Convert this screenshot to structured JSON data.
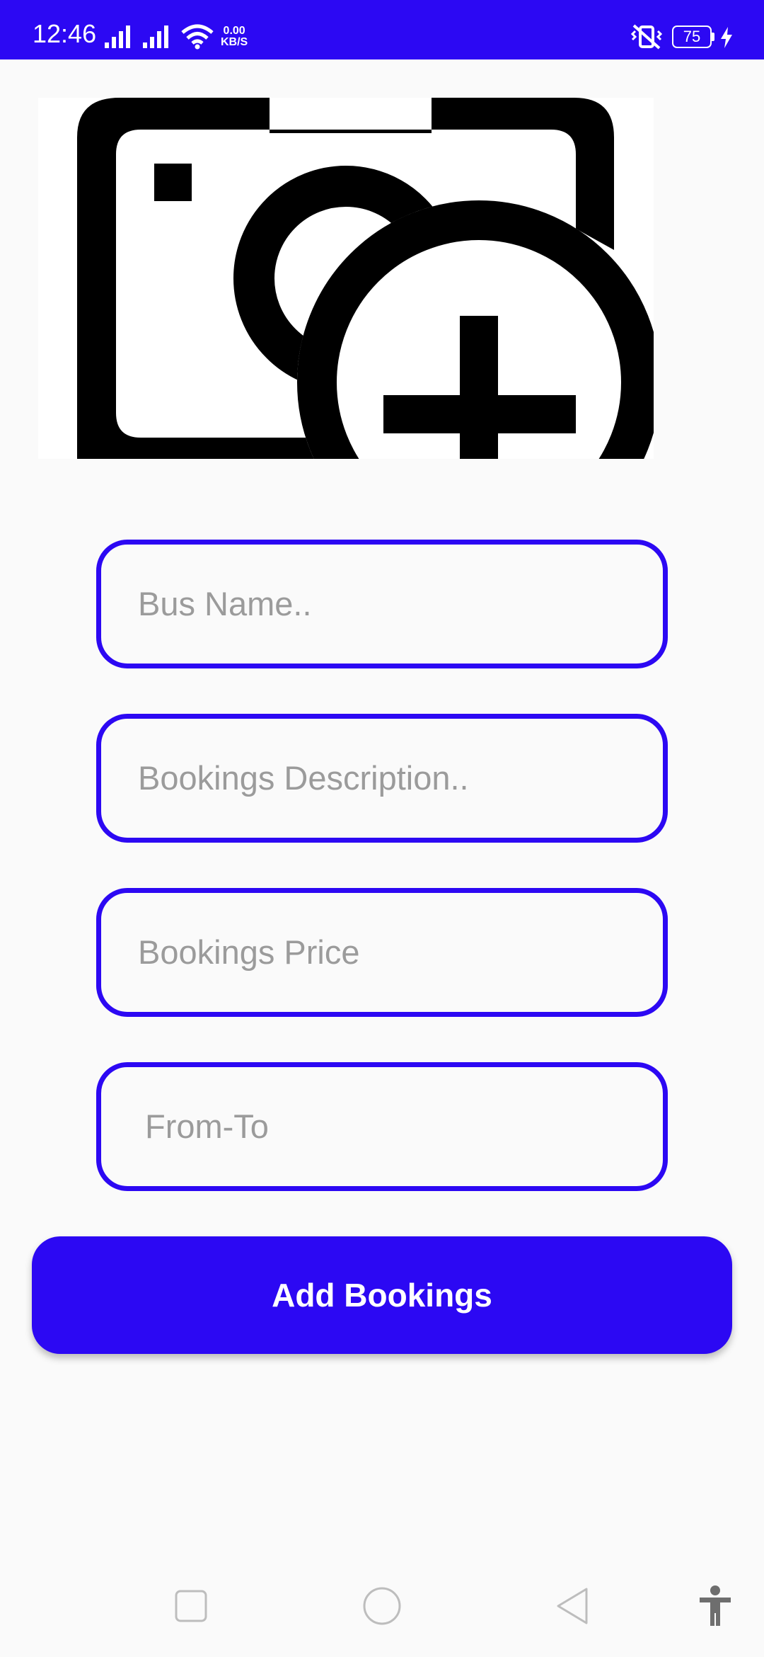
{
  "status_bar": {
    "time": "12:46",
    "net_speed_value": "0.00",
    "net_speed_unit": "KB/S",
    "battery_level": "75",
    "icons": [
      "signal-icon",
      "signal-icon",
      "wifi-icon",
      "vibrate-icon",
      "battery-icon",
      "charging-icon"
    ],
    "background_color": "#2C08F3"
  },
  "image_picker": {
    "icon": "add-photo-icon"
  },
  "form": {
    "bus_name_placeholder": "Bus Name..",
    "description_placeholder": "Bookings Description..",
    "price_placeholder": "Bookings Price",
    "from_to_placeholder": "From-To",
    "accent_color": "#2C08F3"
  },
  "actions": {
    "add_bookings_label": "Add Bookings"
  },
  "nav_bar": {
    "icons": [
      "recents-icon",
      "home-icon",
      "back-icon",
      "accessibility-icon"
    ]
  }
}
